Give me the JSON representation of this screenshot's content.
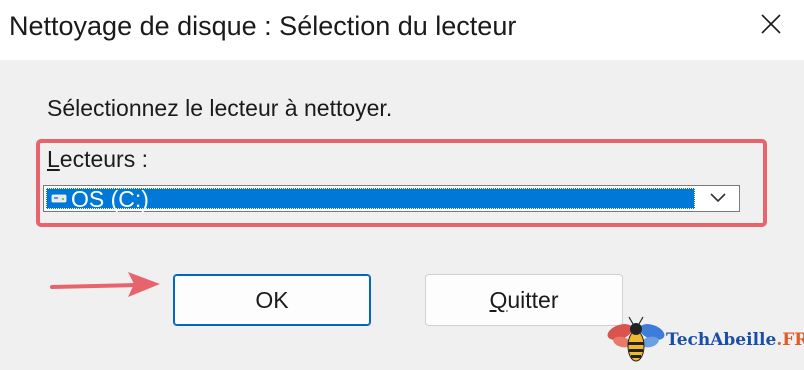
{
  "window": {
    "title": "Nettoyage de disque : Sélection du lecteur"
  },
  "dialog": {
    "instruction": "Sélectionnez le lecteur à nettoyer.",
    "drives_label_accel": "L",
    "drives_label_rest": "ecteurs :",
    "selected_drive": "OS (C:)",
    "ok_label": "OK",
    "quit_label_accel": "Q",
    "quit_label_rest": "uitter"
  },
  "watermark": {
    "brand_name": "TechAbeille",
    "brand_tld": ".FR"
  },
  "colors": {
    "selection": "#0078d7",
    "highlight_frame": "#e8646c",
    "pointer_arrow": "#e8646c",
    "ok_border": "#0067c0"
  },
  "icons": {
    "close": "close-icon",
    "drive": "drive-icon",
    "dropdown": "chevron-down-icon",
    "pointer": "arrow-right-icon",
    "logo": "bee-logo-icon"
  }
}
